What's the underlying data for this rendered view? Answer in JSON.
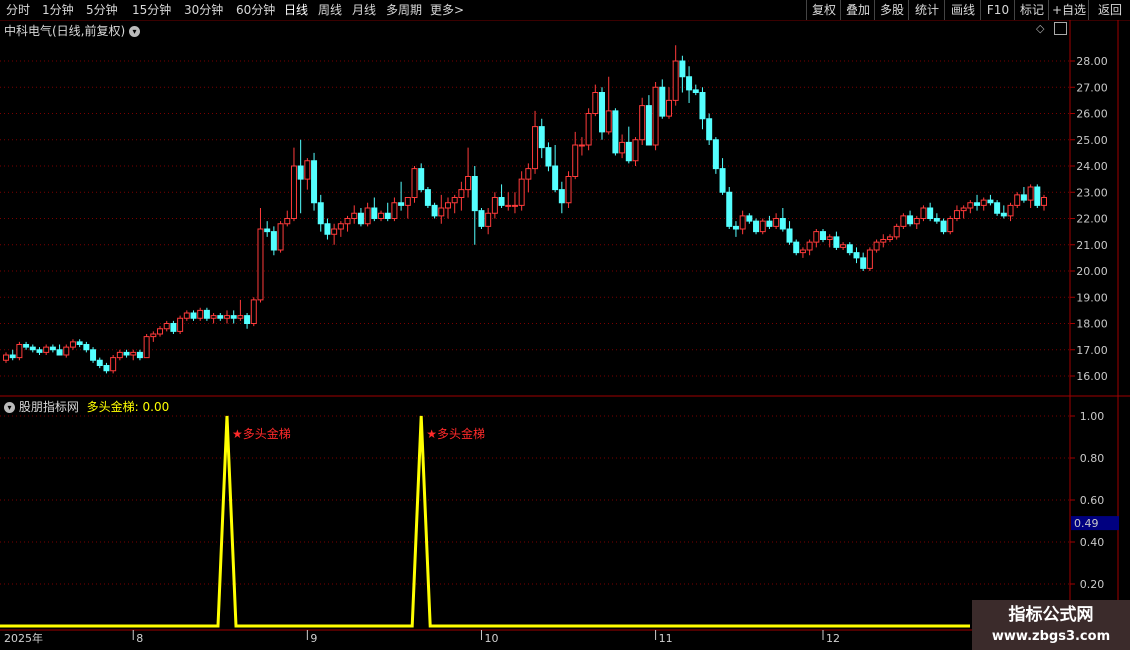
{
  "toolbar": {
    "periods": [
      "分时",
      "1分钟",
      "5分钟",
      "15分钟",
      "30分钟",
      "60分钟",
      "日线",
      "周线",
      "月线",
      "多周期",
      "更多"
    ],
    "active_period": "日线",
    "more_chevron": ">",
    "right_buttons": [
      "复权",
      "叠加",
      "多股",
      "统计",
      "画线",
      "F10",
      "标记",
      "+自选",
      "返回"
    ]
  },
  "stock_title": "中科电气(日线,前复权)",
  "indicator": {
    "name": "股朋指标网",
    "value_text": "多头金梯: 0.00",
    "signal_label": "多头金梯",
    "cursor_value": "0.49"
  },
  "watermark": {
    "line1": "指标公式网",
    "line2": "www.zbgs3.com"
  },
  "colors": {
    "up": "#ff3b3b",
    "down": "#54ffff",
    "line": "#ffff00",
    "grid": "#7a0000",
    "border": "#a00000"
  },
  "chart_data": [
    {
      "type": "candlestick",
      "y_ticks": [
        "28.00",
        "27.00",
        "26.00",
        "25.00",
        "24.00",
        "23.00",
        "22.00",
        "21.00",
        "20.00",
        "19.00",
        "18.00",
        "17.00",
        "16.00"
      ],
      "ylim": [
        15.5,
        29.0
      ],
      "x_labels": [
        "2025年",
        "8",
        "9",
        "10",
        "11",
        "12",
        "1"
      ],
      "ohlc": [
        [
          16.6,
          16.9,
          16.5,
          16.8
        ],
        [
          16.8,
          17.0,
          16.6,
          16.7
        ],
        [
          16.7,
          17.3,
          16.6,
          17.2
        ],
        [
          17.2,
          17.3,
          17.0,
          17.1
        ],
        [
          17.1,
          17.2,
          16.9,
          17.0
        ],
        [
          17.0,
          17.1,
          16.8,
          16.9
        ],
        [
          16.9,
          17.2,
          16.8,
          17.1
        ],
        [
          17.1,
          17.2,
          16.9,
          17.0
        ],
        [
          17.0,
          17.2,
          16.8,
          16.8
        ],
        [
          16.8,
          17.2,
          16.7,
          17.1
        ],
        [
          17.1,
          17.4,
          17.0,
          17.3
        ],
        [
          17.3,
          17.4,
          17.1,
          17.2
        ],
        [
          17.2,
          17.3,
          16.9,
          17.0
        ],
        [
          17.0,
          17.1,
          16.5,
          16.6
        ],
        [
          16.6,
          16.7,
          16.3,
          16.4
        ],
        [
          16.4,
          16.5,
          16.1,
          16.2
        ],
        [
          16.2,
          16.8,
          16.1,
          16.7
        ],
        [
          16.7,
          17.0,
          16.6,
          16.9
        ],
        [
          16.9,
          17.0,
          16.7,
          16.8
        ],
        [
          16.8,
          17.0,
          16.6,
          16.9
        ],
        [
          16.9,
          17.0,
          16.6,
          16.7
        ],
        [
          16.7,
          17.6,
          16.7,
          17.5
        ],
        [
          17.5,
          17.7,
          17.3,
          17.6
        ],
        [
          17.6,
          17.9,
          17.5,
          17.8
        ],
        [
          17.8,
          18.1,
          17.7,
          18.0
        ],
        [
          18.0,
          18.1,
          17.6,
          17.7
        ],
        [
          17.7,
          18.3,
          17.6,
          18.2
        ],
        [
          18.2,
          18.5,
          18.1,
          18.4
        ],
        [
          18.4,
          18.5,
          18.1,
          18.2
        ],
        [
          18.2,
          18.6,
          18.1,
          18.5
        ],
        [
          18.5,
          18.6,
          18.1,
          18.2
        ],
        [
          18.2,
          18.4,
          18.0,
          18.3
        ],
        [
          18.3,
          18.4,
          18.1,
          18.2
        ],
        [
          18.2,
          18.5,
          18.0,
          18.3
        ],
        [
          18.3,
          18.5,
          18.0,
          18.2
        ],
        [
          18.2,
          18.9,
          18.1,
          18.3
        ],
        [
          18.3,
          18.4,
          17.8,
          18.0
        ],
        [
          18.0,
          19.0,
          17.9,
          18.9
        ],
        [
          18.9,
          22.4,
          18.8,
          21.6
        ],
        [
          21.6,
          21.9,
          21.3,
          21.5
        ],
        [
          21.5,
          21.7,
          20.6,
          20.8
        ],
        [
          20.8,
          21.9,
          20.7,
          21.8
        ],
        [
          21.8,
          22.3,
          21.7,
          22.0
        ],
        [
          22.0,
          24.7,
          21.9,
          24.0
        ],
        [
          24.0,
          25.0,
          22.2,
          23.5
        ],
        [
          23.5,
          24.3,
          23.1,
          24.2
        ],
        [
          24.2,
          24.5,
          22.3,
          22.6
        ],
        [
          22.6,
          22.9,
          21.5,
          21.8
        ],
        [
          21.8,
          22.0,
          21.2,
          21.4
        ],
        [
          21.4,
          21.8,
          21.0,
          21.6
        ],
        [
          21.6,
          21.9,
          21.3,
          21.8
        ],
        [
          21.8,
          22.1,
          21.5,
          22.0
        ],
        [
          22.0,
          22.5,
          21.8,
          22.2
        ],
        [
          22.2,
          22.4,
          21.7,
          21.8
        ],
        [
          21.8,
          22.6,
          21.7,
          22.4
        ],
        [
          22.4,
          22.8,
          21.9,
          22.0
        ],
        [
          22.0,
          22.3,
          21.9,
          22.2
        ],
        [
          22.2,
          22.6,
          21.9,
          22.0
        ],
        [
          22.0,
          22.8,
          21.9,
          22.6
        ],
        [
          22.6,
          23.4,
          22.3,
          22.5
        ],
        [
          22.5,
          22.8,
          22.0,
          22.8
        ],
        [
          22.8,
          24.0,
          22.6,
          23.9
        ],
        [
          23.9,
          24.1,
          23.0,
          23.1
        ],
        [
          23.1,
          23.2,
          22.4,
          22.5
        ],
        [
          22.5,
          22.6,
          22.0,
          22.1
        ],
        [
          22.1,
          22.9,
          21.8,
          22.4
        ],
        [
          22.4,
          22.8,
          22.0,
          22.6
        ],
        [
          22.6,
          22.9,
          22.2,
          22.8
        ],
        [
          22.8,
          23.4,
          22.3,
          23.1
        ],
        [
          23.1,
          24.7,
          22.8,
          23.6
        ],
        [
          23.6,
          24.0,
          21.0,
          22.3
        ],
        [
          22.3,
          22.4,
          21.6,
          21.7
        ],
        [
          21.7,
          22.4,
          21.4,
          22.2
        ],
        [
          22.2,
          23.0,
          22.0,
          22.8
        ],
        [
          22.8,
          23.3,
          22.4,
          22.5
        ],
        [
          22.5,
          23.0,
          22.3,
          22.5
        ],
        [
          22.5,
          23.0,
          22.2,
          22.5
        ],
        [
          22.5,
          23.8,
          22.3,
          23.5
        ],
        [
          23.5,
          24.1,
          23.0,
          23.9
        ],
        [
          23.9,
          26.1,
          23.7,
          25.5
        ],
        [
          25.5,
          25.8,
          24.3,
          24.7
        ],
        [
          24.7,
          24.9,
          23.8,
          24.0
        ],
        [
          24.0,
          24.8,
          23.0,
          23.1
        ],
        [
          23.1,
          23.4,
          22.2,
          22.6
        ],
        [
          22.6,
          23.8,
          22.4,
          23.6
        ],
        [
          23.6,
          25.3,
          23.5,
          24.8
        ],
        [
          24.8,
          25.1,
          24.4,
          24.8
        ],
        [
          24.8,
          26.2,
          24.6,
          26.0
        ],
        [
          26.0,
          27.1,
          25.9,
          26.8
        ],
        [
          26.8,
          27.0,
          25.0,
          25.3
        ],
        [
          25.3,
          27.4,
          25.2,
          26.1
        ],
        [
          26.1,
          26.2,
          24.4,
          24.5
        ],
        [
          24.5,
          25.2,
          24.3,
          24.9
        ],
        [
          24.9,
          25.5,
          24.1,
          24.2
        ],
        [
          24.2,
          25.1,
          24.0,
          25.0
        ],
        [
          25.0,
          26.6,
          24.8,
          26.3
        ],
        [
          26.3,
          26.7,
          24.8,
          24.8
        ],
        [
          24.8,
          27.2,
          24.6,
          27.0
        ],
        [
          27.0,
          27.3,
          25.8,
          25.9
        ],
        [
          25.9,
          27.0,
          25.8,
          26.5
        ],
        [
          26.5,
          28.6,
          26.3,
          28.0
        ],
        [
          28.0,
          28.2,
          26.8,
          27.4
        ],
        [
          27.4,
          27.8,
          26.4,
          26.9
        ],
        [
          26.9,
          27.1,
          26.7,
          26.8
        ],
        [
          26.8,
          27.0,
          25.4,
          25.8
        ],
        [
          25.8,
          26.0,
          24.8,
          25.0
        ],
        [
          25.0,
          25.1,
          23.7,
          23.9
        ],
        [
          23.9,
          24.3,
          22.9,
          23.0
        ],
        [
          23.0,
          23.2,
          21.6,
          21.7
        ],
        [
          21.7,
          21.9,
          21.3,
          21.6
        ],
        [
          21.6,
          22.3,
          21.4,
          22.1
        ],
        [
          22.1,
          22.2,
          21.8,
          21.9
        ],
        [
          21.9,
          22.0,
          21.4,
          21.5
        ],
        [
          21.5,
          22.0,
          21.4,
          21.9
        ],
        [
          21.9,
          22.1,
          21.6,
          21.7
        ],
        [
          21.7,
          22.2,
          21.6,
          22.0
        ],
        [
          22.0,
          22.4,
          21.5,
          21.6
        ],
        [
          21.6,
          21.9,
          21.0,
          21.1
        ],
        [
          21.1,
          21.2,
          20.6,
          20.7
        ],
        [
          20.7,
          20.9,
          20.5,
          20.8
        ],
        [
          20.8,
          21.2,
          20.6,
          21.1
        ],
        [
          21.1,
          21.6,
          20.9,
          21.5
        ],
        [
          21.5,
          21.6,
          21.1,
          21.2
        ],
        [
          21.2,
          21.4,
          20.9,
          21.3
        ],
        [
          21.3,
          21.5,
          20.8,
          20.9
        ],
        [
          20.9,
          21.1,
          20.8,
          21.0
        ],
        [
          21.0,
          21.1,
          20.6,
          20.7
        ],
        [
          20.7,
          20.9,
          20.3,
          20.5
        ],
        [
          20.5,
          20.7,
          20.0,
          20.1
        ],
        [
          20.1,
          20.9,
          20.0,
          20.8
        ],
        [
          20.8,
          21.2,
          20.7,
          21.1
        ],
        [
          21.1,
          21.4,
          20.9,
          21.2
        ],
        [
          21.2,
          21.4,
          21.1,
          21.3
        ],
        [
          21.3,
          21.8,
          21.2,
          21.7
        ],
        [
          21.7,
          22.2,
          21.6,
          22.1
        ],
        [
          22.1,
          22.3,
          21.7,
          21.8
        ],
        [
          21.8,
          22.1,
          21.6,
          22.0
        ],
        [
          22.0,
          22.5,
          21.9,
          22.4
        ],
        [
          22.4,
          22.6,
          21.9,
          22.0
        ],
        [
          22.0,
          22.2,
          21.8,
          21.9
        ],
        [
          21.9,
          22.0,
          21.4,
          21.5
        ],
        [
          21.5,
          22.1,
          21.4,
          22.0
        ],
        [
          22.0,
          22.5,
          21.9,
          22.3
        ],
        [
          22.3,
          22.5,
          22.0,
          22.4
        ],
        [
          22.4,
          22.7,
          22.2,
          22.6
        ],
        [
          22.6,
          22.9,
          22.3,
          22.5
        ],
        [
          22.5,
          22.8,
          22.3,
          22.7
        ],
        [
          22.7,
          22.9,
          22.5,
          22.6
        ],
        [
          22.6,
          22.7,
          22.1,
          22.2
        ],
        [
          22.2,
          22.5,
          22.0,
          22.1
        ],
        [
          22.1,
          22.6,
          21.9,
          22.5
        ],
        [
          22.5,
          23.0,
          22.4,
          22.9
        ],
        [
          22.9,
          23.2,
          22.6,
          22.7
        ],
        [
          22.7,
          23.3,
          22.4,
          23.2
        ],
        [
          23.2,
          23.3,
          22.4,
          22.5
        ],
        [
          22.5,
          22.9,
          22.3,
          22.8
        ]
      ]
    },
    {
      "type": "line",
      "name": "多头金梯",
      "y_ticks": [
        "1.00",
        "0.80",
        "0.60",
        "0.40",
        "0.20"
      ],
      "ylim": [
        0,
        1.0
      ],
      "signal_bars": [
        33,
        62
      ]
    }
  ]
}
